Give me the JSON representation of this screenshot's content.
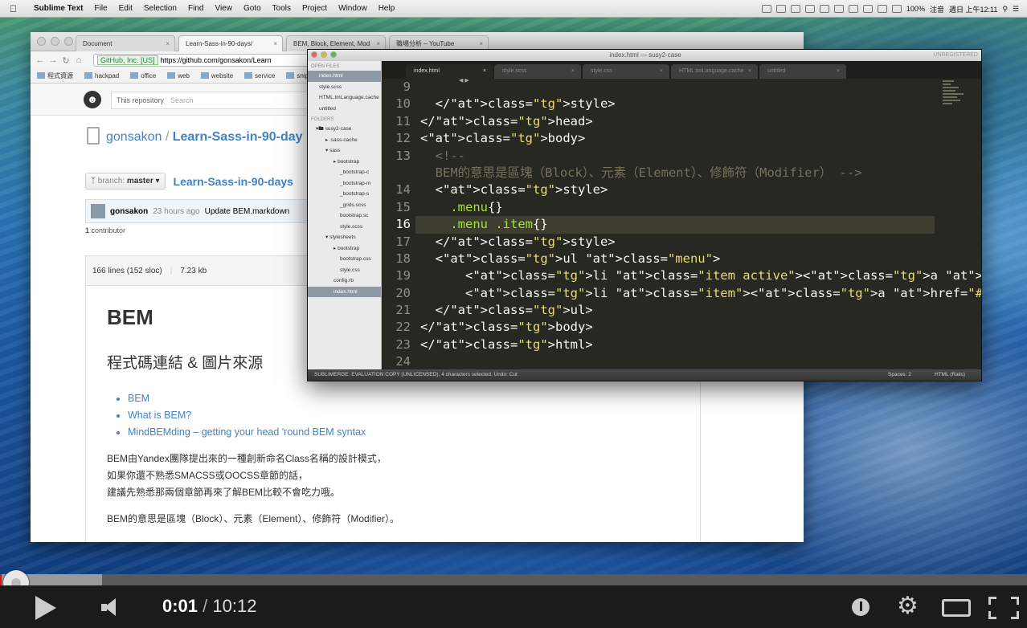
{
  "menubar": {
    "app_name": "Sublime Text",
    "items": [
      "File",
      "Edit",
      "Selection",
      "Find",
      "View",
      "Goto",
      "Tools",
      "Project",
      "Window",
      "Help"
    ],
    "battery": "100%",
    "input_method": "注音",
    "clock": "週日 上午12:11"
  },
  "browser": {
    "tabs": [
      {
        "label": "Document"
      },
      {
        "label": "Learn-Sass-in-90-days/"
      },
      {
        "label": "BEM, Block, Element, Mod"
      },
      {
        "label": "職場分析 – YouTube"
      }
    ],
    "cert_label": "GitHub, Inc. [US]",
    "url": "https://github.com/gonsakon/Learn",
    "bookmarks": [
      "程式資源",
      "hackpad",
      "office",
      "web",
      "website",
      "service",
      "snippet"
    ],
    "search_scope": "This repository",
    "search_placeholder": "Search",
    "repo_owner": "gonsakon",
    "repo_sep": " / ",
    "repo_name": "Learn-Sass-in-90-day",
    "branch_label": "branch:",
    "branch_name": "master",
    "branch_path": "Learn-Sass-in-90-days",
    "commit_author": "gonsakon",
    "commit_ago": "23 hours ago",
    "commit_message": "Update BEM.markdown",
    "contributors_count": "1",
    "contributors_label": "contributor",
    "file_lines": "166 lines (152 sloc)",
    "file_size": "7.23 kb",
    "readme": {
      "h1": "BEM",
      "h2": "程式碼連結 & 圖片來源",
      "links": [
        "BEM",
        "What is BEM?",
        "MindBEMding – getting your head 'round BEM syntax"
      ],
      "p1": "BEM由Yandex團隊提出來的一種創新命名Class名稱的設計模式，",
      "p2": "如果你還不熟悉SMACSS或OOCSS章節的話，",
      "p3": "建議先熟悉那兩個章節再來了解BEM比較不會吃力哦。",
      "p4": "BEM的意思是區塊（Block）、元素（Element）、修飾符（Modifier）。"
    }
  },
  "sublime": {
    "window_title": "index.html — susy2-case",
    "unregistered": "UNREGISTERED",
    "sidebar": {
      "open_files_header": "OPEN FILES",
      "open_files": [
        "index.html",
        "style.scss",
        "HTML.tmLanguage.cache",
        "untitled"
      ],
      "folders_header": "FOLDERS",
      "folders": [
        "susy2-case",
        ".sass-cache",
        "sass",
        "bootstrap",
        "_bootstrap-c",
        "_bootstrap-m",
        "_bootstrap-s",
        "_grids.scss",
        "bootstrap.sc",
        "style.scss",
        "stylesheets",
        "bootstrap",
        "bootstrap.css",
        "style.css",
        "config.rb",
        "index.html"
      ]
    },
    "tabs": [
      "index.html",
      "style.scss",
      "style.css",
      "HTML.tmLanguage.cache",
      "untitled"
    ],
    "line_numbers": [
      "9",
      "10",
      "11",
      "12",
      "13",
      "",
      "14",
      "15",
      "16",
      "17",
      "18",
      "19",
      "20",
      "21",
      "22",
      "23",
      "24"
    ],
    "code_lines": [
      "",
      "  </style>",
      "</head>",
      "<body>",
      "  <!--",
      "  BEM的意思是區塊（Block）、元素（Element）、修飾符（Modifier） -->",
      "  <style>",
      "    .menu{}",
      "    .menu .item{}",
      "  </style>",
      "  <ul class=\"menu\">",
      "      <li class=\"item active\"><a href=\"#\"></a></li>",
      "      <li class=\"item\"><a href=\"#\"></a></li>",
      "  </ul>",
      "</body>",
      "</html>",
      ""
    ],
    "status_left": "SUBLIMERGE: EVALUATION COPY (UNLICENSED), 4 characters selected, Undo: Cut",
    "status_spaces": "Spaces: 2",
    "status_syntax": "HTML (Rails)"
  },
  "player": {
    "current_time": "0:01",
    "separator": "/",
    "duration": "10:12",
    "played_fraction": 0.0016,
    "buffered_fraction": 0.099
  }
}
